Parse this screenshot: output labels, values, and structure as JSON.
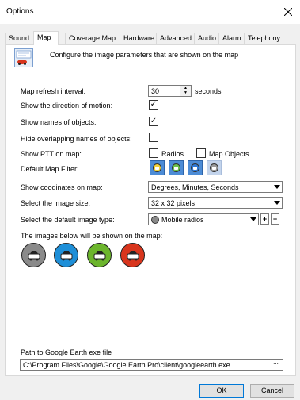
{
  "window": {
    "title": "Options",
    "close_glyph": "×"
  },
  "tabs": [
    {
      "label": "Sound"
    },
    {
      "label": "Map",
      "active": true
    },
    {
      "label": "Coverage Map"
    },
    {
      "label": "Hardware"
    },
    {
      "label": "Advanced"
    },
    {
      "label": "Audio"
    },
    {
      "label": "Alarm"
    },
    {
      "label": "Telephony"
    }
  ],
  "header": {
    "icon": "map-car-icon",
    "text": "Configure the image parameters that are shown on the map"
  },
  "settings": {
    "refresh_label": "Map refresh interval:",
    "refresh_value": "30",
    "refresh_unit": "seconds",
    "direction_label": "Show the direction of motion:",
    "direction_checked": true,
    "names_label": "Show names of objects:",
    "names_checked": true,
    "hide_overlap_label": "Hide overlapping names of objects:",
    "hide_overlap_checked": false,
    "ptt_label": "Show PTT on map:",
    "ptt_radios_label": "Radios",
    "ptt_radios_checked": false,
    "ptt_objects_label": "Map Objects",
    "ptt_objects_checked": false,
    "filter_label": "Default Map Filter:",
    "filter_buttons": [
      {
        "icon": "yellow-car-filter-icon",
        "color": "#f2d23a",
        "active": true
      },
      {
        "icon": "green-car-filter-icon",
        "color": "#6cc24a",
        "active": true
      },
      {
        "icon": "blue-car-filter-icon",
        "color": "#2f79d6",
        "active": true
      },
      {
        "icon": "gray-car-filter-icon",
        "color": "#9a9a9a",
        "active": false
      }
    ],
    "coords_label": "Show coodinates on map:",
    "coords_value": "Degrees, Minutes, Seconds",
    "size_label": "Select the image size:",
    "size_value": "32 x 32 pixels",
    "type_label": "Select the default image type:",
    "type_value": "Mobile radios",
    "type_add": "+",
    "type_remove": "−",
    "shown_label": "The images below will be shown on the map:",
    "shown_images": [
      {
        "icon": "gray-car-icon",
        "color": "#8a8a8a"
      },
      {
        "icon": "blue-car-icon",
        "color": "#1e8fd8"
      },
      {
        "icon": "green-car-icon",
        "color": "#6cb52d"
      },
      {
        "icon": "red-car-icon",
        "color": "#d8351d"
      }
    ]
  },
  "google_earth": {
    "label": "Path to Google Earth exe file",
    "path": "C:\\Program Files\\Google\\Google Earth Pro\\client\\googleearth.exe",
    "browse": "..."
  },
  "buttons": {
    "ok": "OK",
    "cancel": "Cancel"
  },
  "colors": {
    "accent": "#0078d7",
    "filter_active": "#4c8cd6"
  }
}
